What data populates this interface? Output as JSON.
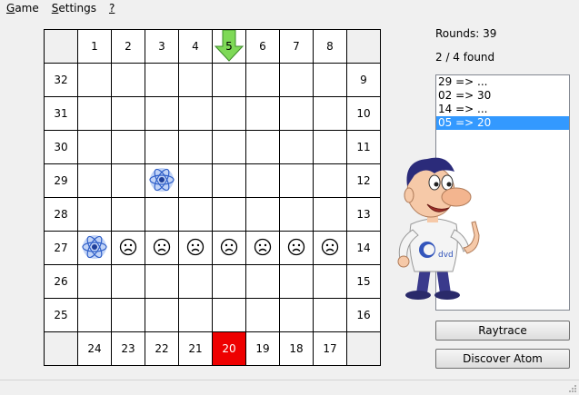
{
  "menu": {
    "items": [
      {
        "mnemonic": "G",
        "rest": "ame"
      },
      {
        "mnemonic": "S",
        "rest": "ettings"
      },
      {
        "mnemonic": "?",
        "rest": ""
      }
    ]
  },
  "status": {
    "rounds": "Rounds: 39",
    "found": "2 / 4 found"
  },
  "log": {
    "entries": [
      "29 => ...",
      "02 => 30",
      "14 => ...",
      "05 => 20"
    ],
    "selected_index": 3
  },
  "buttons": {
    "raytrace": "Raytrace",
    "discover": "Discover Atom"
  },
  "board": {
    "top": [
      "1",
      "2",
      "3",
      "4",
      "5",
      "6",
      "7",
      "8"
    ],
    "bottom": [
      "24",
      "23",
      "22",
      "21",
      "20",
      "19",
      "18",
      "17"
    ],
    "left": [
      "32",
      "31",
      "30",
      "29",
      "28",
      "27",
      "26",
      "25"
    ],
    "right": [
      "9",
      "10",
      "11",
      "12",
      "13",
      "14",
      "15",
      "16"
    ],
    "entry_arrow_label": "5",
    "highlight_label": "20",
    "highlight_color": "#ee0000",
    "arrow_color": "#7ed957",
    "atoms": [
      {
        "row": 4,
        "col": 3
      },
      {
        "row": 6,
        "col": 1
      }
    ],
    "faces": [
      {
        "row": 6,
        "col": 2
      },
      {
        "row": 6,
        "col": 3
      },
      {
        "row": 6,
        "col": 4
      },
      {
        "row": 6,
        "col": 5
      },
      {
        "row": 6,
        "col": 6
      },
      {
        "row": 6,
        "col": 7
      },
      {
        "row": 6,
        "col": 8
      }
    ]
  },
  "mascot": {
    "shirt_text": "dvd"
  }
}
